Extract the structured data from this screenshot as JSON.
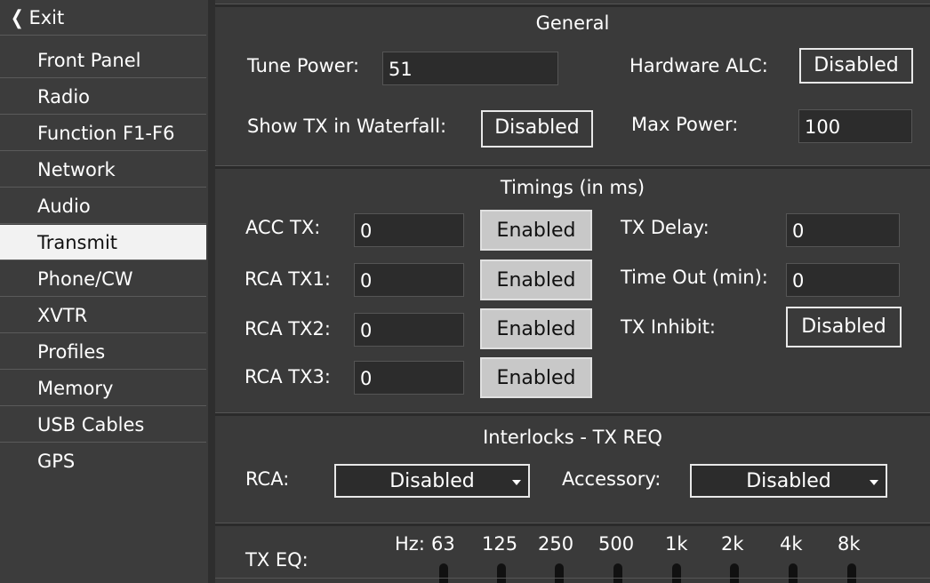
{
  "sidebar": {
    "exit_label": "Exit",
    "items": [
      {
        "label": "Front Panel"
      },
      {
        "label": "Radio"
      },
      {
        "label": "Function F1-F6"
      },
      {
        "label": "Network"
      },
      {
        "label": "Audio"
      },
      {
        "label": "Transmit",
        "active": true
      },
      {
        "label": "Phone/CW"
      },
      {
        "label": "XVTR"
      },
      {
        "label": "Profiles"
      },
      {
        "label": "Memory"
      },
      {
        "label": "USB Cables"
      },
      {
        "label": "GPS"
      }
    ]
  },
  "general": {
    "title": "General",
    "tune_power_label": "Tune Power:",
    "tune_power_value": "51",
    "hardware_alc_label": "Hardware ALC:",
    "hardware_alc_value": "Disabled",
    "show_tx_label": "Show TX in Waterfall:",
    "show_tx_value": "Disabled",
    "max_power_label": "Max Power:",
    "max_power_value": "100"
  },
  "timings": {
    "title": "Timings (in ms)",
    "acc_tx_label": "ACC TX:",
    "acc_tx_value": "0",
    "acc_tx_state": "Enabled",
    "rca_tx1_label": "RCA TX1:",
    "rca_tx1_value": "0",
    "rca_tx1_state": "Enabled",
    "rca_tx2_label": "RCA TX2:",
    "rca_tx2_value": "0",
    "rca_tx2_state": "Enabled",
    "rca_tx3_label": "RCA TX3:",
    "rca_tx3_value": "0",
    "rca_tx3_state": "Enabled",
    "tx_delay_label": "TX Delay:",
    "tx_delay_value": "0",
    "timeout_label": "Time Out (min):",
    "timeout_value": "0",
    "tx_inhibit_label": "TX Inhibit:",
    "tx_inhibit_value": "Disabled"
  },
  "interlocks": {
    "title": "Interlocks - TX REQ",
    "rca_label": "RCA:",
    "rca_value": "Disabled",
    "accessory_label": "Accessory:",
    "accessory_value": "Disabled"
  },
  "tx_eq": {
    "label": "TX EQ:",
    "hz_label": "Hz:",
    "bands": [
      "63",
      "125",
      "250",
      "500",
      "1k",
      "2k",
      "4k",
      "8k"
    ]
  },
  "colors": {
    "background": "#3a3a3a",
    "field": "#2c2c2c",
    "active_nav": "#f2f2f2",
    "enabled_button": "#c8c8c8"
  }
}
